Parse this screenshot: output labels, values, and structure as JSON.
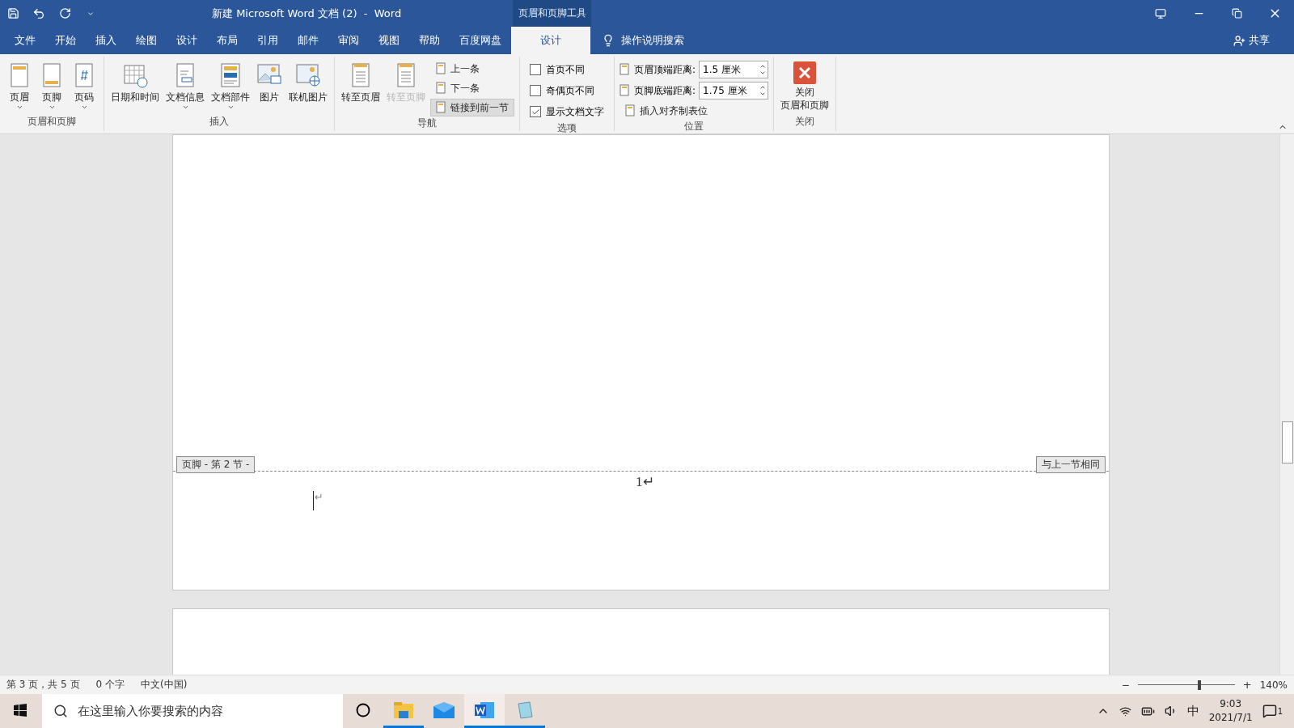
{
  "title_bar": {
    "title": "新建 Microsoft Word 文档 (2)  -  Word",
    "context_title": "页眉和页脚工具"
  },
  "menu_tabs": [
    {
      "label": "文件",
      "selected": false
    },
    {
      "label": "开始",
      "selected": false
    },
    {
      "label": "插入",
      "selected": false
    },
    {
      "label": "绘图",
      "selected": false
    },
    {
      "label": "设计",
      "selected": false
    },
    {
      "label": "布局",
      "selected": false
    },
    {
      "label": "引用",
      "selected": false
    },
    {
      "label": "邮件",
      "selected": false
    },
    {
      "label": "审阅",
      "selected": false
    },
    {
      "label": "视图",
      "selected": false
    },
    {
      "label": "帮助",
      "selected": false
    },
    {
      "label": "百度网盘",
      "selected": false
    },
    {
      "label": "设计",
      "selected": true
    }
  ],
  "tell_me": "操作说明搜索",
  "share": "共享",
  "ribbon_groups": [
    {
      "label": "页眉和页脚",
      "items": [
        {
          "kind": "large",
          "label": "页眉",
          "dropdown": true,
          "disabled": false
        },
        {
          "kind": "large",
          "label": "页脚",
          "dropdown": true,
          "disabled": false
        },
        {
          "kind": "large",
          "label": "页码",
          "dropdown": true,
          "disabled": false
        }
      ]
    },
    {
      "label": "插入",
      "items": [
        {
          "kind": "large",
          "label": "日期和时间",
          "dropdown": false,
          "disabled": false
        },
        {
          "kind": "large",
          "label": "文档信息",
          "dropdown": true,
          "disabled": false
        },
        {
          "kind": "large",
          "label": "文档部件",
          "dropdown": true,
          "disabled": false
        },
        {
          "kind": "large",
          "label": "图片",
          "dropdown": false,
          "disabled": false
        },
        {
          "kind": "large",
          "label": "联机图片",
          "dropdown": false,
          "disabled": false
        }
      ]
    },
    {
      "label": "导航",
      "items": [
        {
          "kind": "large",
          "label": "转至页眉",
          "dropdown": false,
          "disabled": false
        },
        {
          "kind": "large",
          "label": "转至页脚",
          "dropdown": false,
          "disabled": true
        },
        {
          "kind": "stack",
          "rows": [
            {
              "label": "上一条",
              "pressed": false
            },
            {
              "label": "下一条",
              "pressed": false
            },
            {
              "label": "链接到前一节",
              "pressed": true
            }
          ]
        }
      ]
    },
    {
      "label": "选项",
      "items": [
        {
          "kind": "checks",
          "rows": [
            {
              "label": "首页不同",
              "checked": false
            },
            {
              "label": "奇偶页不同",
              "checked": false
            },
            {
              "label": "显示文档文字",
              "checked": true
            }
          ]
        }
      ]
    },
    {
      "label": "位置",
      "items": [
        {
          "kind": "position",
          "spinners": [
            {
              "label": "页眉顶端距离:",
              "value": "1.5 厘米"
            },
            {
              "label": "页脚底端距离:",
              "value": "1.75 厘米"
            }
          ],
          "button": "插入对齐制表位"
        }
      ]
    },
    {
      "label": "关闭",
      "items": [
        {
          "kind": "close",
          "lines": [
            "关闭",
            "页眉和页脚"
          ]
        }
      ]
    }
  ],
  "document": {
    "footer_tag": "页脚 - 第 2 节 -",
    "same_as_previous": "与上一节相同",
    "page_number": "1↵",
    "paragraph_mark": "↵"
  },
  "status_bar": {
    "page_info": "第 3 页，共 5 页",
    "word_count": "0 个字",
    "language": "中文(中国)",
    "zoom_out": "−",
    "zoom_in": "+",
    "zoom": "140%",
    "zoom_slider": {
      "level": 0.62
    }
  },
  "taskbar": {
    "search_placeholder": "在这里输入你要搜索的内容",
    "apps": [
      {
        "running": true,
        "selected": false
      },
      {
        "running": false,
        "selected": false
      },
      {
        "running": true,
        "selected": true
      },
      {
        "running": true,
        "selected": false
      }
    ],
    "ime": "中",
    "time": "9:03",
    "date": "2021/7/1",
    "notifications": "1"
  }
}
